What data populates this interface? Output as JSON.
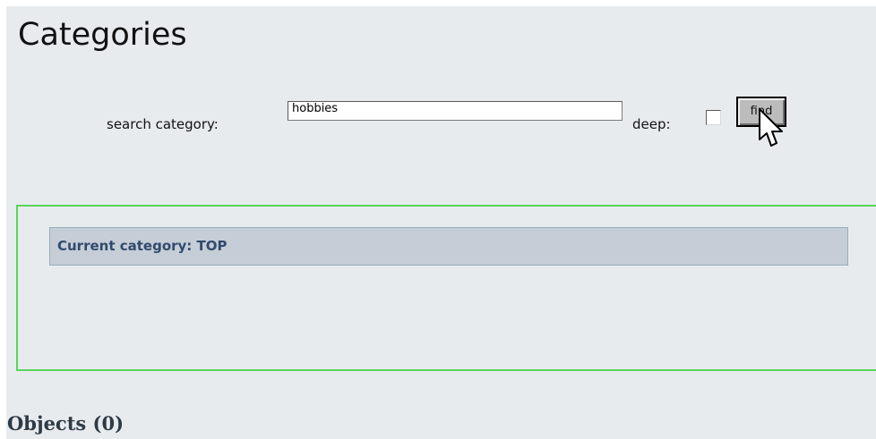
{
  "page": {
    "title": "Categories"
  },
  "search": {
    "label": "search category:",
    "value": "hobbies",
    "deep_label": "deep:",
    "deep_checked": false,
    "find_label": "find"
  },
  "category": {
    "current_label": "Current category: TOP"
  },
  "objects": {
    "heading": "Objects (0)"
  },
  "colors": {
    "page_background": "#e8ebee",
    "category_border": "#58d658",
    "current_category_background": "#c5cdd7",
    "current_category_text": "#324a6d"
  },
  "icons": {
    "cursor": "mouse-pointer-icon"
  }
}
